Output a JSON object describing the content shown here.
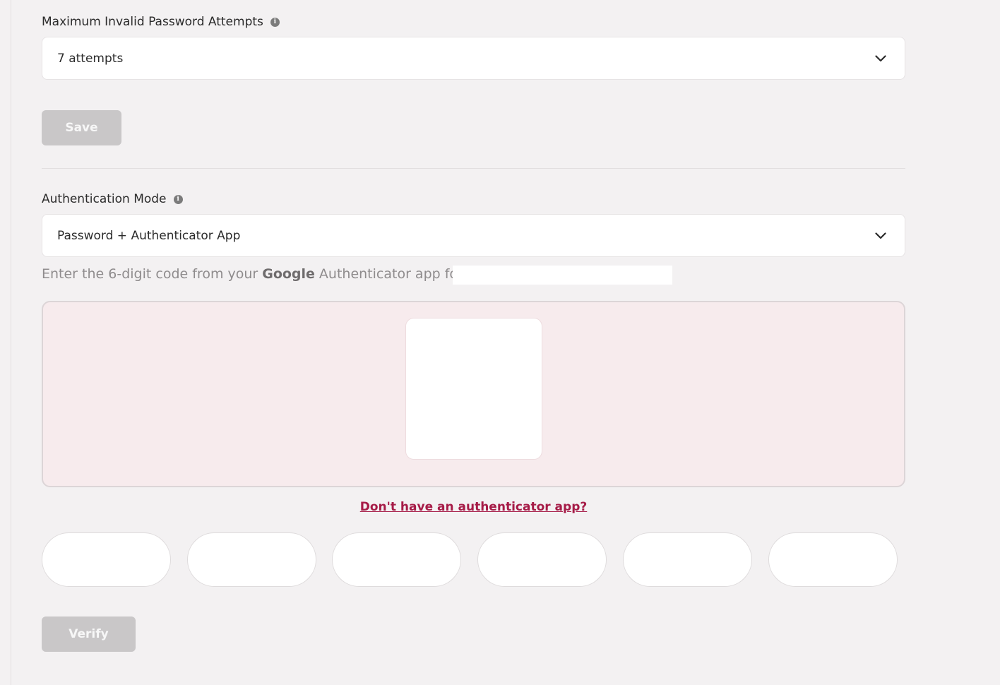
{
  "password_attempts": {
    "label": "Maximum Invalid Password Attempts",
    "selected": "7 attempts"
  },
  "save_button": "Save",
  "auth_mode": {
    "label": "Authentication Mode",
    "selected": "Password + Authenticator App"
  },
  "hint": {
    "prefix": "Enter the 6-digit code from your",
    "brand": "Google",
    "suffix": "Authenticator app for"
  },
  "no_app_link": "Don't have an authenticator app?",
  "verify_button": "Verify",
  "code_digits": [
    "",
    "",
    "",
    "",
    "",
    ""
  ],
  "colors": {
    "background": "#f3f1f2",
    "accent_link": "#a61b47",
    "qr_panel_bg": "#f7ebed",
    "disabled_button": "#c9c7c8"
  },
  "icons": {
    "info": "info-icon",
    "dropdown": "chevron-down-icon"
  }
}
